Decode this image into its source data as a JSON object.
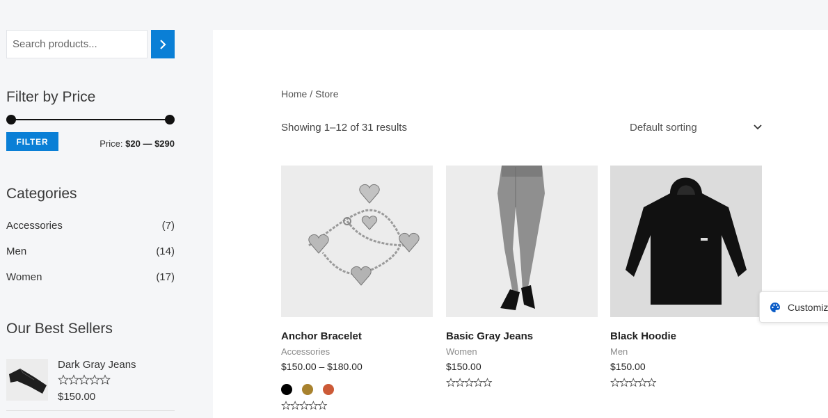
{
  "sidebar": {
    "search": {
      "placeholder": "Search products..."
    },
    "filter": {
      "title": "Filter by Price",
      "button_label": "FILTER",
      "price_label": "Price:",
      "price_value": "$20 — $290",
      "slider_min_fraction": 0,
      "slider_max_fraction": 1
    },
    "categories": {
      "title": "Categories",
      "items": [
        {
          "label": "Accessories",
          "count": "(7)"
        },
        {
          "label": "Men",
          "count": "(14)"
        },
        {
          "label": "Women",
          "count": "(17)"
        }
      ]
    },
    "best_sellers": {
      "title": "Our Best Sellers",
      "items": [
        {
          "name": "Dark Gray Jeans",
          "price": "$150.00",
          "rating": 0
        }
      ]
    }
  },
  "main": {
    "breadcrumb": {
      "home": "Home",
      "sep": " / ",
      "current": "Store"
    },
    "result_count": "Showing 1–12 of 31 results",
    "sorting": "Default sorting",
    "products": [
      {
        "name": "Anchor Bracelet",
        "category": "Accessories",
        "price": "$150.00 – $180.00",
        "swatches": [
          "#000000",
          "#a8822e",
          "#cc5a37"
        ],
        "rating": 0
      },
      {
        "name": "Basic Gray Jeans",
        "category": "Women",
        "price": "$150.00",
        "rating": 0
      },
      {
        "name": "Black Hoodie",
        "category": "Men",
        "price": "$150.00",
        "rating": 0
      }
    ]
  },
  "customize": {
    "label": "Customize",
    "icon": "palette-icon"
  },
  "colors": {
    "accent": "#0a7fd6",
    "page_bg": "#f5f6f8"
  }
}
